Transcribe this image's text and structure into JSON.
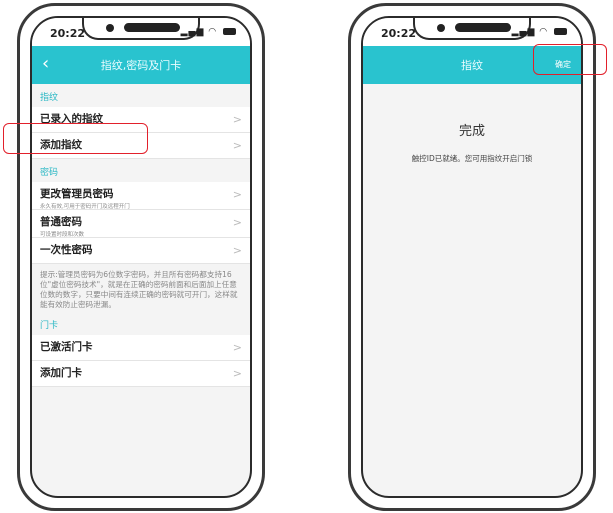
{
  "left": {
    "status": {
      "time": "20:22"
    },
    "nav": {
      "back": "‹",
      "title": "指纹,密码及门卡"
    },
    "sections": {
      "fingerprint": "指纹",
      "password": "密码",
      "card": "门卡"
    },
    "items": {
      "enrolled": "已录入的指纹",
      "add_fp": "添加指纹",
      "change_admin": "更改管理员密码",
      "change_admin_sub": "永久有效,可用于密码开门及远程开门",
      "normal_pwd": "普通密码",
      "normal_pwd_sub": "可设置时段和次数",
      "onetime": "一次性密码",
      "activated_card": "已激活门卡",
      "add_card": "添加门卡"
    },
    "note": "提示:管理员密码为6位数字密码，并且所有密码都支持16位\"虚位密码技术\"，就是在正确的密码前面和后面加上任意位数的数字，只要中间有连续正确的密码就可开门，这样就能有效防止密码泄漏。",
    "chevron": ">"
  },
  "right": {
    "status": {
      "time": "20:22"
    },
    "nav": {
      "title": "指纹",
      "confirm": "确定"
    },
    "done_title": "完成",
    "done_msg": "触控ID已就绪。您可用指纹开启门锁"
  },
  "colors": {
    "accent": "#29c3cf",
    "highlight": "#e2202b"
  },
  "icons": [
    "back-icon",
    "chevron-right-icon",
    "signal-icon",
    "wifi-icon",
    "battery-icon"
  ]
}
